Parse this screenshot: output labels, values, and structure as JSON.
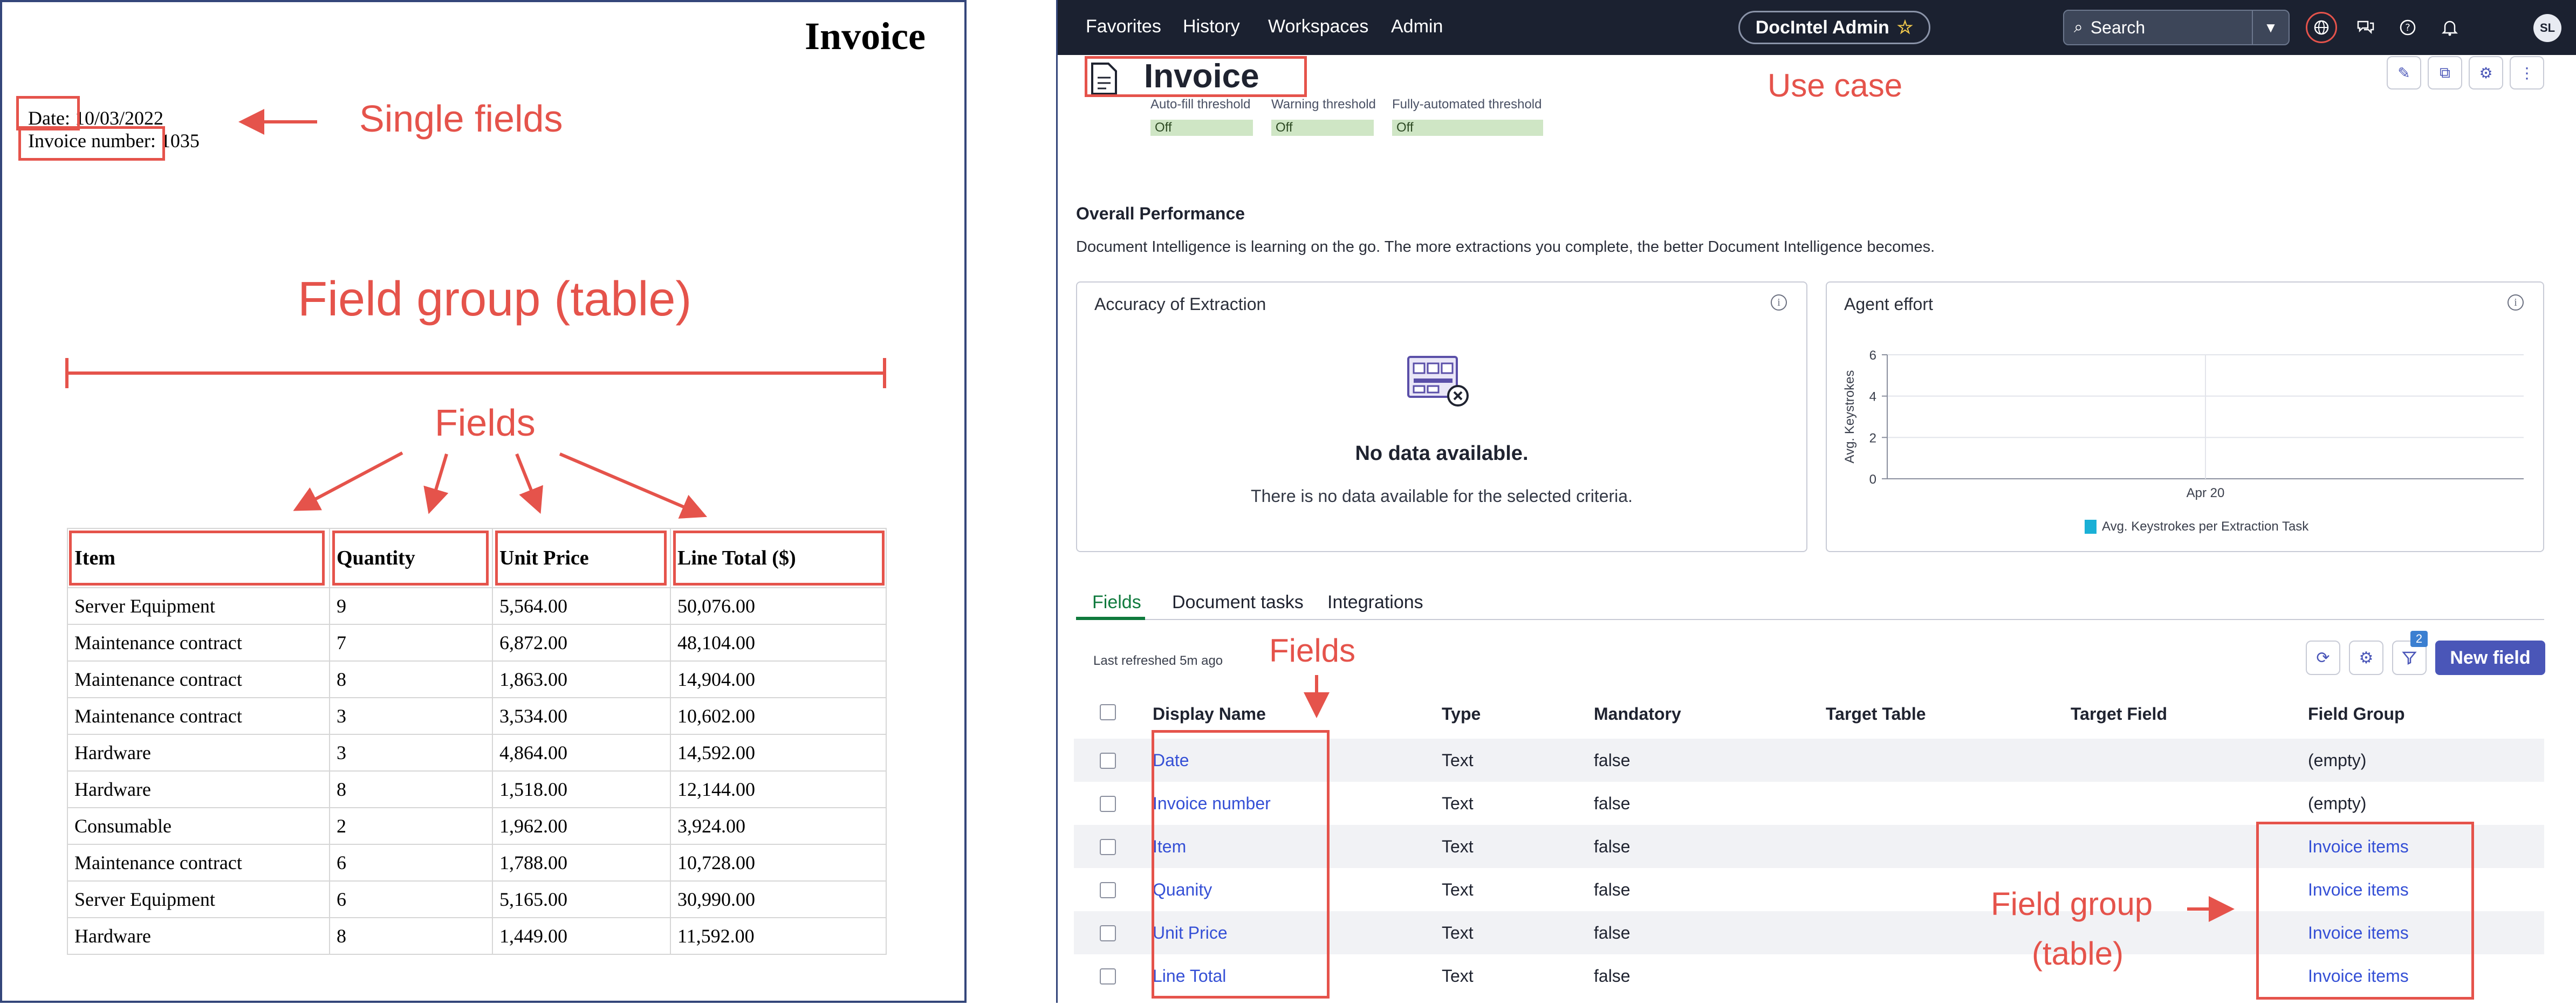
{
  "document": {
    "title": "Invoice",
    "date_label": "Date:",
    "date_value": "10/03/2022",
    "invoice_number_label": "Invoice number:",
    "invoice_number_value": "1035",
    "table": {
      "headers": [
        "Item",
        "Quantity",
        "Unit Price",
        "Line Total ($)"
      ],
      "rows": [
        [
          "Server Equipment",
          "9",
          "5,564.00",
          "50,076.00"
        ],
        [
          "Maintenance contract",
          "7",
          "6,872.00",
          "48,104.00"
        ],
        [
          "Maintenance contract",
          "8",
          "1,863.00",
          "14,904.00"
        ],
        [
          "Maintenance contract",
          "3",
          "3,534.00",
          "10,602.00"
        ],
        [
          "Hardware",
          "3",
          "4,864.00",
          "14,592.00"
        ],
        [
          "Hardware",
          "8",
          "1,518.00",
          "12,144.00"
        ],
        [
          "Consumable",
          "2",
          "1,962.00",
          "3,924.00"
        ],
        [
          "Maintenance contract",
          "6",
          "1,788.00",
          "10,728.00"
        ],
        [
          "Server Equipment",
          "6",
          "5,165.00",
          "30,990.00"
        ],
        [
          "Hardware",
          "8",
          "1,449.00",
          "11,592.00"
        ]
      ]
    }
  },
  "annotations": {
    "single_fields": "Single fields",
    "field_group_table": "Field group (table)",
    "fields_doc": "Fields",
    "use_case": "Use case",
    "fields_app": "Fields",
    "field_group_line1": "Field group",
    "field_group_line2": "(table)"
  },
  "app": {
    "nav": [
      "Favorites",
      "History",
      "Workspaces",
      "Admin"
    ],
    "app_name": "DocIntel Admin",
    "search_placeholder": "Search",
    "avatar_initials": "SL",
    "use_case_title": "Invoice",
    "thresholds": [
      {
        "label": "Auto-fill threshold",
        "value": "Off"
      },
      {
        "label": "Warning threshold",
        "value": "Off"
      },
      {
        "label": "Fully-automated threshold",
        "value": "Off"
      }
    ],
    "performance": {
      "heading": "Overall Performance",
      "description": "Document Intelligence is learning on the go. The more extractions you complete, the better Document Intelligence becomes.",
      "accuracy_card": {
        "title": "Accuracy of Extraction",
        "empty_title": "No data available.",
        "empty_text": "There is no data available for the selected criteria."
      },
      "agent_card": {
        "title": "Agent effort"
      }
    },
    "tabs": [
      "Fields",
      "Document tasks",
      "Integrations"
    ],
    "active_tab": "Fields",
    "last_refreshed": "Last refreshed 5m ago",
    "filter_badge": "2",
    "new_field_label": "New field",
    "columns": [
      "Display Name",
      "Type",
      "Mandatory",
      "Target Table",
      "Target Field",
      "Field Group"
    ],
    "fields": [
      {
        "name": "Date",
        "type": "Text",
        "mandatory": "false",
        "group": "(empty)",
        "group_link": false
      },
      {
        "name": "Invoice number",
        "type": "Text",
        "mandatory": "false",
        "group": "(empty)",
        "group_link": false
      },
      {
        "name": "Item",
        "type": "Text",
        "mandatory": "false",
        "group": "Invoice items",
        "group_link": true
      },
      {
        "name": "Quanity",
        "type": "Text",
        "mandatory": "false",
        "group": "Invoice items",
        "group_link": true
      },
      {
        "name": "Unit Price",
        "type": "Text",
        "mandatory": "false",
        "group": "Invoice items",
        "group_link": true
      },
      {
        "name": "Line Total",
        "type": "Text",
        "mandatory": "false",
        "group": "Invoice items",
        "group_link": true
      }
    ]
  },
  "chart_data": {
    "type": "line",
    "title": "Agent effort",
    "ylabel": "Avg. Keystrokes",
    "ylim": [
      0,
      6
    ],
    "yticks": [
      "0",
      "2",
      "4",
      "6"
    ],
    "categories": [
      "Apr 20"
    ],
    "series": [
      {
        "name": "Avg. Keystrokes per Extraction Task",
        "values": []
      }
    ],
    "grid": true,
    "legend": "bottom",
    "colors": {
      "series": "#1ab0d6"
    }
  },
  "colors": {
    "annotation_red": "#e5534b",
    "topbar": "#1b2130",
    "accent": "#4a56b8",
    "link": "#3550d6",
    "active_tab": "#0f7a3d"
  }
}
